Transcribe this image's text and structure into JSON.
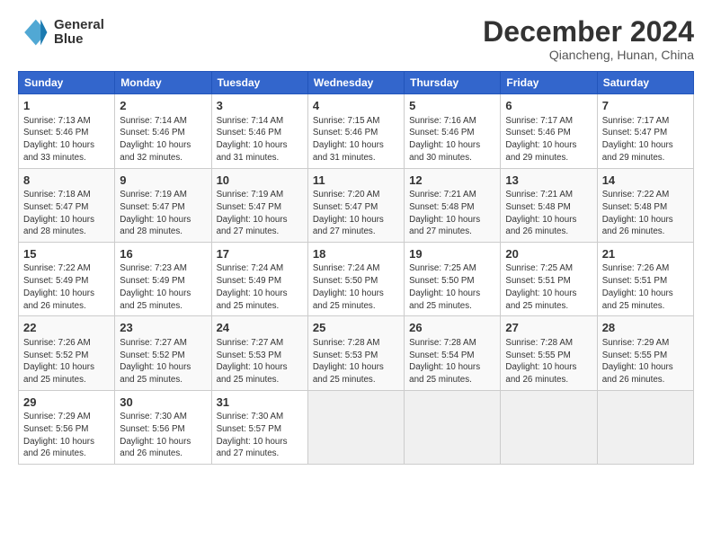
{
  "header": {
    "logo_line1": "General",
    "logo_line2": "Blue",
    "month": "December 2024",
    "location": "Qiancheng, Hunan, China"
  },
  "weekdays": [
    "Sunday",
    "Monday",
    "Tuesday",
    "Wednesday",
    "Thursday",
    "Friday",
    "Saturday"
  ],
  "weeks": [
    [
      {
        "day": "1",
        "info": "Sunrise: 7:13 AM\nSunset: 5:46 PM\nDaylight: 10 hours\nand 33 minutes."
      },
      {
        "day": "2",
        "info": "Sunrise: 7:14 AM\nSunset: 5:46 PM\nDaylight: 10 hours\nand 32 minutes."
      },
      {
        "day": "3",
        "info": "Sunrise: 7:14 AM\nSunset: 5:46 PM\nDaylight: 10 hours\nand 31 minutes."
      },
      {
        "day": "4",
        "info": "Sunrise: 7:15 AM\nSunset: 5:46 PM\nDaylight: 10 hours\nand 31 minutes."
      },
      {
        "day": "5",
        "info": "Sunrise: 7:16 AM\nSunset: 5:46 PM\nDaylight: 10 hours\nand 30 minutes."
      },
      {
        "day": "6",
        "info": "Sunrise: 7:17 AM\nSunset: 5:46 PM\nDaylight: 10 hours\nand 29 minutes."
      },
      {
        "day": "7",
        "info": "Sunrise: 7:17 AM\nSunset: 5:47 PM\nDaylight: 10 hours\nand 29 minutes."
      }
    ],
    [
      {
        "day": "8",
        "info": "Sunrise: 7:18 AM\nSunset: 5:47 PM\nDaylight: 10 hours\nand 28 minutes."
      },
      {
        "day": "9",
        "info": "Sunrise: 7:19 AM\nSunset: 5:47 PM\nDaylight: 10 hours\nand 28 minutes."
      },
      {
        "day": "10",
        "info": "Sunrise: 7:19 AM\nSunset: 5:47 PM\nDaylight: 10 hours\nand 27 minutes."
      },
      {
        "day": "11",
        "info": "Sunrise: 7:20 AM\nSunset: 5:47 PM\nDaylight: 10 hours\nand 27 minutes."
      },
      {
        "day": "12",
        "info": "Sunrise: 7:21 AM\nSunset: 5:48 PM\nDaylight: 10 hours\nand 27 minutes."
      },
      {
        "day": "13",
        "info": "Sunrise: 7:21 AM\nSunset: 5:48 PM\nDaylight: 10 hours\nand 26 minutes."
      },
      {
        "day": "14",
        "info": "Sunrise: 7:22 AM\nSunset: 5:48 PM\nDaylight: 10 hours\nand 26 minutes."
      }
    ],
    [
      {
        "day": "15",
        "info": "Sunrise: 7:22 AM\nSunset: 5:49 PM\nDaylight: 10 hours\nand 26 minutes."
      },
      {
        "day": "16",
        "info": "Sunrise: 7:23 AM\nSunset: 5:49 PM\nDaylight: 10 hours\nand 25 minutes."
      },
      {
        "day": "17",
        "info": "Sunrise: 7:24 AM\nSunset: 5:49 PM\nDaylight: 10 hours\nand 25 minutes."
      },
      {
        "day": "18",
        "info": "Sunrise: 7:24 AM\nSunset: 5:50 PM\nDaylight: 10 hours\nand 25 minutes."
      },
      {
        "day": "19",
        "info": "Sunrise: 7:25 AM\nSunset: 5:50 PM\nDaylight: 10 hours\nand 25 minutes."
      },
      {
        "day": "20",
        "info": "Sunrise: 7:25 AM\nSunset: 5:51 PM\nDaylight: 10 hours\nand 25 minutes."
      },
      {
        "day": "21",
        "info": "Sunrise: 7:26 AM\nSunset: 5:51 PM\nDaylight: 10 hours\nand 25 minutes."
      }
    ],
    [
      {
        "day": "22",
        "info": "Sunrise: 7:26 AM\nSunset: 5:52 PM\nDaylight: 10 hours\nand 25 minutes."
      },
      {
        "day": "23",
        "info": "Sunrise: 7:27 AM\nSunset: 5:52 PM\nDaylight: 10 hours\nand 25 minutes."
      },
      {
        "day": "24",
        "info": "Sunrise: 7:27 AM\nSunset: 5:53 PM\nDaylight: 10 hours\nand 25 minutes."
      },
      {
        "day": "25",
        "info": "Sunrise: 7:28 AM\nSunset: 5:53 PM\nDaylight: 10 hours\nand 25 minutes."
      },
      {
        "day": "26",
        "info": "Sunrise: 7:28 AM\nSunset: 5:54 PM\nDaylight: 10 hours\nand 25 minutes."
      },
      {
        "day": "27",
        "info": "Sunrise: 7:28 AM\nSunset: 5:55 PM\nDaylight: 10 hours\nand 26 minutes."
      },
      {
        "day": "28",
        "info": "Sunrise: 7:29 AM\nSunset: 5:55 PM\nDaylight: 10 hours\nand 26 minutes."
      }
    ],
    [
      {
        "day": "29",
        "info": "Sunrise: 7:29 AM\nSunset: 5:56 PM\nDaylight: 10 hours\nand 26 minutes."
      },
      {
        "day": "30",
        "info": "Sunrise: 7:30 AM\nSunset: 5:56 PM\nDaylight: 10 hours\nand 26 minutes."
      },
      {
        "day": "31",
        "info": "Sunrise: 7:30 AM\nSunset: 5:57 PM\nDaylight: 10 hours\nand 27 minutes."
      },
      {
        "day": "",
        "info": ""
      },
      {
        "day": "",
        "info": ""
      },
      {
        "day": "",
        "info": ""
      },
      {
        "day": "",
        "info": ""
      }
    ]
  ]
}
